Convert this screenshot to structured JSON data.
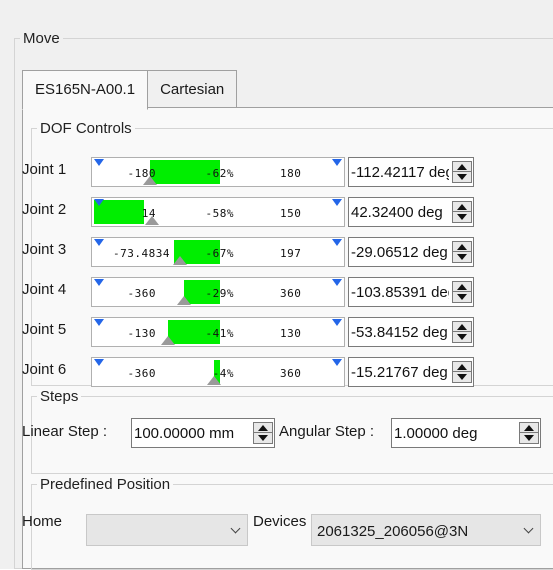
{
  "move_group": {
    "title": "Move"
  },
  "tabs": [
    {
      "label": "ES165N-A00.1",
      "active": true
    },
    {
      "label": "Cartesian",
      "active": false
    }
  ],
  "dof_controls": {
    "title": "DOF Controls",
    "joints": [
      {
        "label": "Joint 1",
        "min": "-180",
        "percent": "-62%",
        "max": "180",
        "value": "-112.42117 deg"
      },
      {
        "label": "Joint 2",
        "min": "14",
        "percent": "-58%",
        "max": "150",
        "value": "42.32400 deg"
      },
      {
        "label": "Joint 3",
        "min": "-73.4834",
        "percent": "-67%",
        "max": "197",
        "value": "-29.06512 deg"
      },
      {
        "label": "Joint 4",
        "min": "-360",
        "percent": "-29%",
        "max": "360",
        "value": "-103.85391 deg"
      },
      {
        "label": "Joint 5",
        "min": "-130",
        "percent": "-41%",
        "max": "130",
        "value": "-53.84152 deg"
      },
      {
        "label": "Joint 6",
        "min": "-360",
        "percent": "-4%",
        "max": "360",
        "value": "-15.21767 deg"
      }
    ]
  },
  "steps": {
    "title": "Steps",
    "linear_label": "Linear Step :",
    "linear_value": "100.00000 mm",
    "angular_label": "Angular Step :",
    "angular_value": "1.00000 deg"
  },
  "predefined_position": {
    "title": "Predefined Position",
    "home_label": "Home",
    "home_value": "",
    "devices_label": "Devices",
    "devices_value": "2061325_206056@3N"
  },
  "colors": {
    "slider_fill": "#00ee00",
    "slider_marker": "#2466e8",
    "slider_thumb": "#9a9a9a"
  }
}
